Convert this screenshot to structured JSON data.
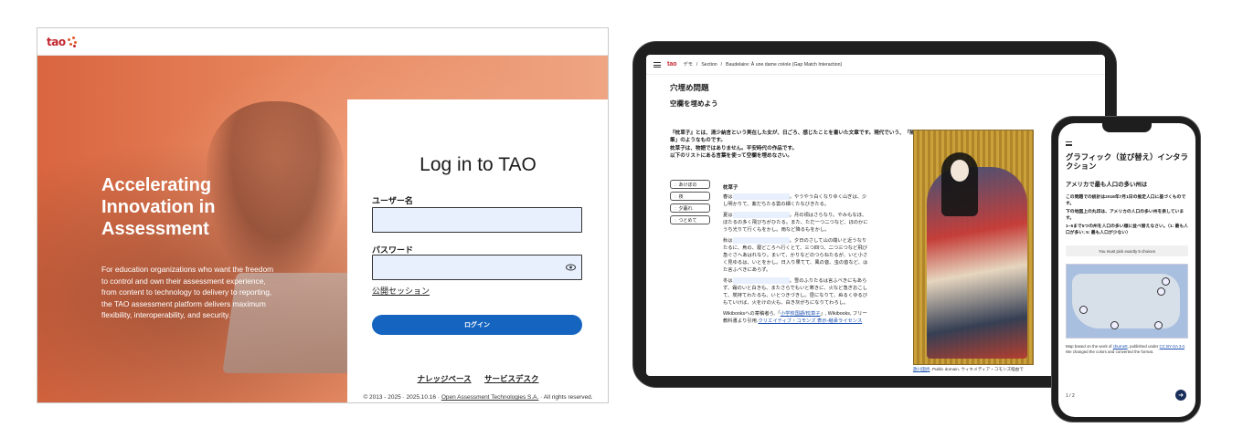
{
  "desktop": {
    "logo_text": "tao",
    "hero_title": "Accelerating Innovation in Assessment",
    "hero_text": "For education organizations who want the freedom to control and own their assessment experience, from content to technology to delivery to reporting, the TAO assessment platform delivers maximum flexibility, interoperability, and security.",
    "login_title": "Log in to TAO",
    "username_label": "ユーザー名",
    "password_label": "パスワード",
    "public_session_link": "公開セッション",
    "login_button": "ログイン",
    "footer_links": [
      "ナレッジベース",
      "サービスデスク"
    ],
    "copyright_prefix": "© 2013 - 2025 · 2025.10.16 · ",
    "copyright_link": "Open Assessment Technologies S.A.",
    "copyright_suffix": " · All rights reserved.",
    "brand_color": "#c2262e",
    "button_color": "#1565c0"
  },
  "tablet": {
    "logo_text": "tao",
    "breadcrumb": [
      "デモ",
      "Section",
      "Baudelaire: À une dame créole (Gap Match Interaction)"
    ],
    "title": "穴埋め問題",
    "subtitle": "空欄を埋めよう",
    "intro": [
      "『枕草子』とは、清少納言という実在した女が、日ごろ、感じたことを書いた文章です。現代でいう、「随筆」のようなものです。",
      "枕草子は、物語ではありません。平安時代の作品です。",
      "以下のリストにある言葉を使って空欄を埋めなさい。"
    ],
    "choices": [
      "あけぼの",
      "夜",
      "夕暮れ",
      "つとめて"
    ],
    "poem_title": "枕草子",
    "poem": [
      {
        "before": "春は",
        "after": "。やうやう白くなりゆく山ぎは、少し明かりて、紫だちたる雲の細くたなびきたる。"
      },
      {
        "before": "夏は",
        "after": "。月の頃はさらなり。やみもなほ、ほたるの多く飛びちがひたる。また、ただ一つ二つなど、ほのかにうち光りて行くもをかし。雨など降るもをかし。"
      },
      {
        "before": "秋は",
        "after": "。夕日のさして山の端いと近うなりたるに、烏の、寝どころへ行くとて、三つ四つ、二つ三つなど飛び急ぐさへあはれなり。まいて、かりなどのつらねたるが、いと小さく見ゆるは、いとをかし。日入り果てて、風の音、虫の音など、はた言ふべきにあらず。"
      },
      {
        "before": "冬は",
        "after": "。雪のふりたるは言ふべきにもあらず、霜のいと白きも、またさらでもいと寒きに、火など急ぎおこして、炭持てわたるも、いとつきづきし。昼になりて、ぬるくゆるびもていけば、火をけの火も、白き灰がちになりてわろし。"
      }
    ],
    "source_prefix": "Wikibooksへの寄稿者ら,「",
    "source_link1": "小学校国語/枕草子",
    "source_middle": "」, Wikibooks, フリー教科書より引用.",
    "source_link2": "クリエイティブ・コモンズ 表示-継承ライセンス",
    "image_caption_link": "歌川国貞",
    "image_caption_text": ", Public domain, ウィキメディア・コモンズ経由で"
  },
  "phone": {
    "title": "グラフィック（並び替え）インタラクション",
    "subtitle": "アメリカで最も人口の多い州は",
    "text": [
      "この問題での統計は2018年7月1日の推定人口に基づくものです。",
      "下の地図上の丸印は、アメリカの人口の多い州を表しています。",
      "1~5まで5つの州を人口の多い順に並べ替えなさい。（1: 最も人口が多い; 5: 最も人口が少ない）"
    ],
    "notice": "You must pick exactly 5 choices",
    "caption_prefix": "Map based on the work of ",
    "caption_link1": "cburnett",
    "caption_middle": ", published under ",
    "caption_link2": "CC BY-SA 3.0",
    "caption_suffix": ". We changed the colors and converted the format.",
    "page_indicator": "1 / 2",
    "next_icon": "arrow-right-icon"
  }
}
